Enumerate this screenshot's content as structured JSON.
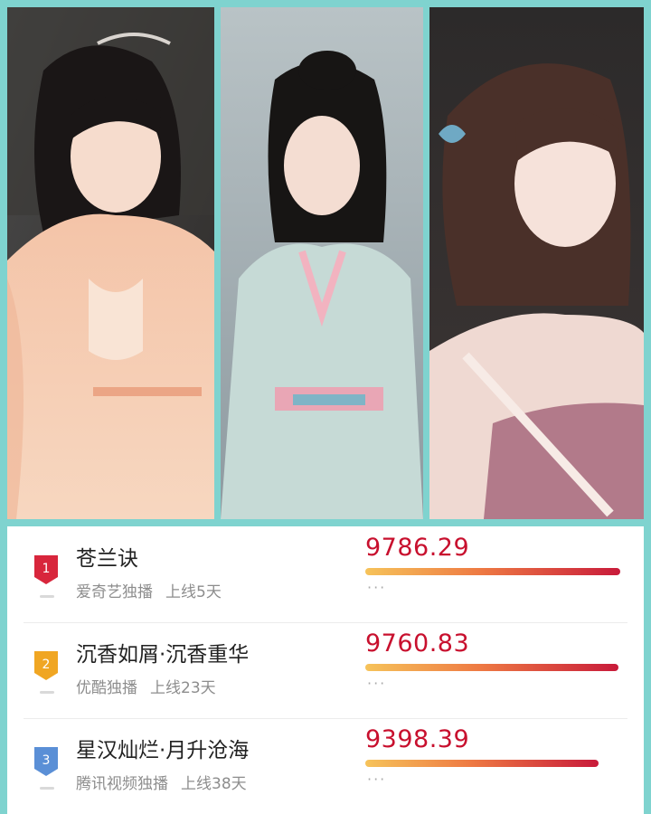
{
  "photos": [
    {
      "name": "actress-peach-costume",
      "watermark": ""
    },
    {
      "name": "actress-mint-costume",
      "watermark": ""
    },
    {
      "name": "actress-purple-costume",
      "watermark": ""
    }
  ],
  "ranking": [
    {
      "rank": "1",
      "title": "苍兰诀",
      "platform": "爱奇艺独播",
      "online": "上线5天",
      "score": "9786.29",
      "score_value": 9786.29,
      "more": "···",
      "badge_color": "#d8263c"
    },
    {
      "rank": "2",
      "title": "沉香如屑·沉香重华",
      "platform": "优酷独播",
      "online": "上线23天",
      "score": "9760.83",
      "score_value": 9760.83,
      "more": "···",
      "badge_color": "#f0a623"
    },
    {
      "rank": "3",
      "title": "星汉灿烂·月升沧海",
      "platform": "腾讯视频独播",
      "online": "上线38天",
      "score": "9398.39",
      "score_value": 9398.39,
      "more": "···",
      "badge_color": "#5a8fd6"
    }
  ]
}
